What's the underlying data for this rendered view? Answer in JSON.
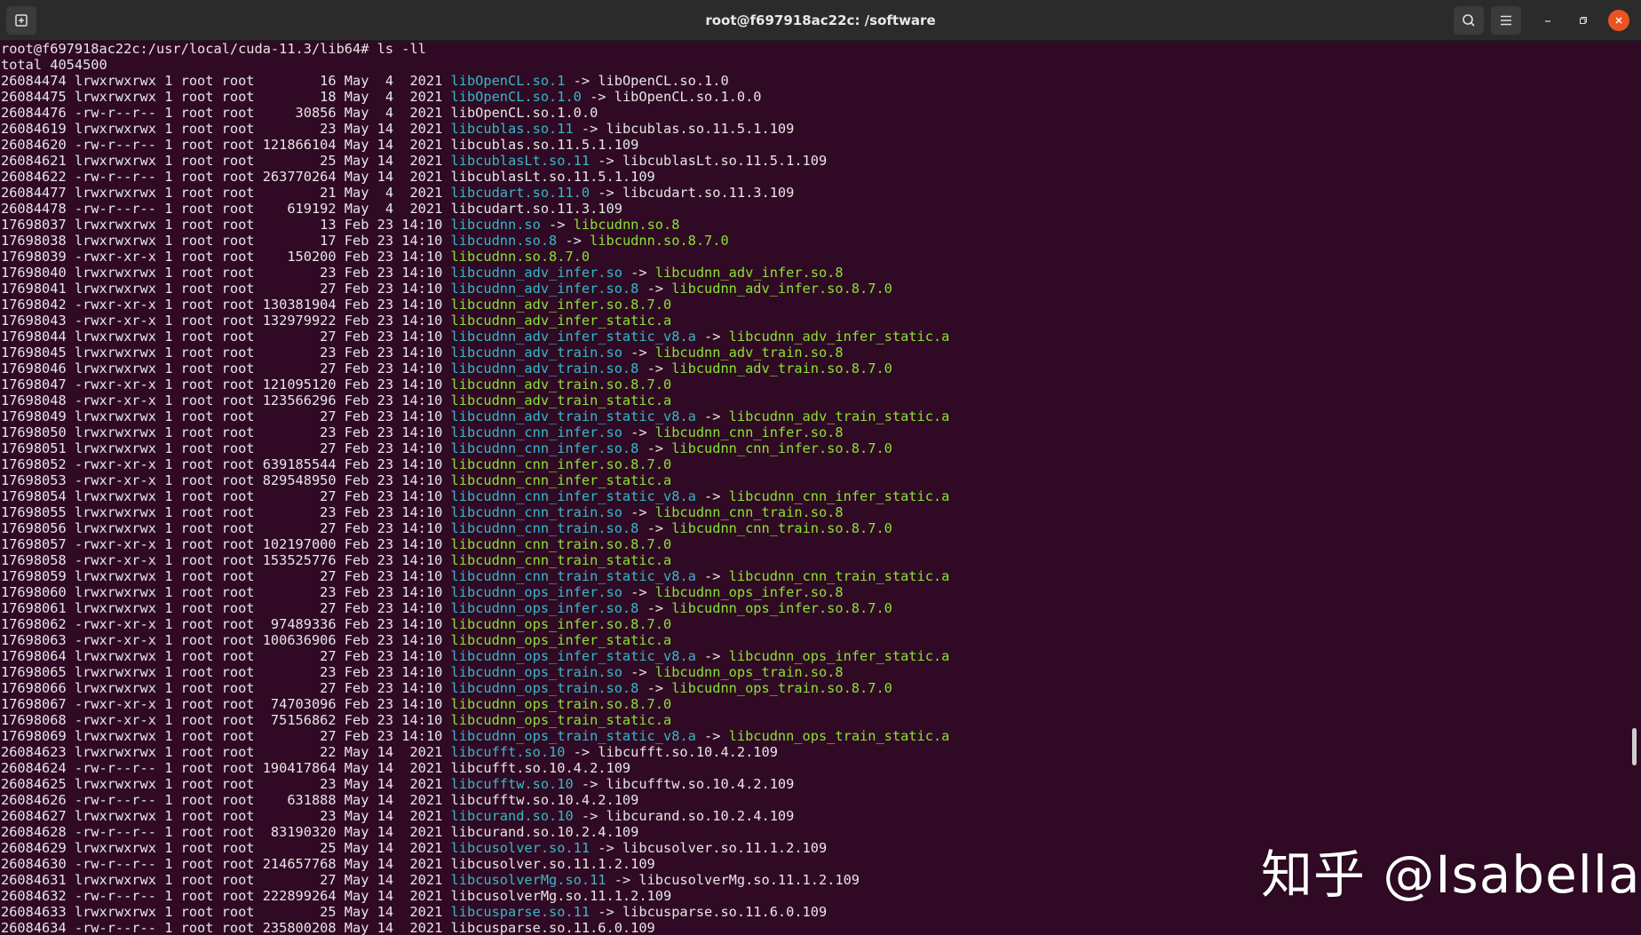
{
  "window": {
    "title": "root@f697918ac22c: /software"
  },
  "icons": {
    "new_tab": "new-tab-icon",
    "search": "search-icon",
    "menu": "hamburger-menu-icon",
    "minimize": "minimize-icon",
    "maximize": "maximize-icon",
    "close": "close-icon"
  },
  "colors": {
    "background": "#300a24",
    "titlebar": "#2b2b2b",
    "symlink": "#34b9c9",
    "executable": "#8ae234",
    "close_button": "#e95420"
  },
  "terminal": {
    "prompt": "root@f697918ac22c:/usr/local/cuda-11.3/lib64# ls -ll",
    "total": "total 4054500",
    "lines": [
      {
        "meta": "26084474 lrwxrwxrwx 1 root root        16 May  4  2021 ",
        "name": "libOpenCL.so.1",
        "kind": "link",
        "target": "libOpenCL.so.1.0",
        "tkind": "plain"
      },
      {
        "meta": "26084475 lrwxrwxrwx 1 root root        18 May  4  2021 ",
        "name": "libOpenCL.so.1.0",
        "kind": "link",
        "target": "libOpenCL.so.1.0.0",
        "tkind": "plain"
      },
      {
        "meta": "26084476 -rw-r--r-- 1 root root     30856 May  4  2021 ",
        "name": "libOpenCL.so.1.0.0",
        "kind": "plain",
        "target": "",
        "tkind": ""
      },
      {
        "meta": "26084619 lrwxrwxrwx 1 root root        23 May 14  2021 ",
        "name": "libcublas.so.11",
        "kind": "link",
        "target": "libcublas.so.11.5.1.109",
        "tkind": "plain"
      },
      {
        "meta": "26084620 -rw-r--r-- 1 root root 121866104 May 14  2021 ",
        "name": "libcublas.so.11.5.1.109",
        "kind": "plain",
        "target": "",
        "tkind": ""
      },
      {
        "meta": "26084621 lrwxrwxrwx 1 root root        25 May 14  2021 ",
        "name": "libcublasLt.so.11",
        "kind": "link",
        "target": "libcublasLt.so.11.5.1.109",
        "tkind": "plain"
      },
      {
        "meta": "26084622 -rw-r--r-- 1 root root 263770264 May 14  2021 ",
        "name": "libcublasLt.so.11.5.1.109",
        "kind": "plain",
        "target": "",
        "tkind": ""
      },
      {
        "meta": "26084477 lrwxrwxrwx 1 root root        21 May  4  2021 ",
        "name": "libcudart.so.11.0",
        "kind": "link",
        "target": "libcudart.so.11.3.109",
        "tkind": "plain"
      },
      {
        "meta": "26084478 -rw-r--r-- 1 root root    619192 May  4  2021 ",
        "name": "libcudart.so.11.3.109",
        "kind": "plain",
        "target": "",
        "tkind": ""
      },
      {
        "meta": "17698037 lrwxrwxrwx 1 root root        13 Feb 23 14:10 ",
        "name": "libcudnn.so",
        "kind": "link",
        "target": "libcudnn.so.8",
        "tkind": "exec"
      },
      {
        "meta": "17698038 lrwxrwxrwx 1 root root        17 Feb 23 14:10 ",
        "name": "libcudnn.so.8",
        "kind": "link",
        "target": "libcudnn.so.8.7.0",
        "tkind": "exec"
      },
      {
        "meta": "17698039 -rwxr-xr-x 1 root root    150200 Feb 23 14:10 ",
        "name": "libcudnn.so.8.7.0",
        "kind": "exec",
        "target": "",
        "tkind": ""
      },
      {
        "meta": "17698040 lrwxrwxrwx 1 root root        23 Feb 23 14:10 ",
        "name": "libcudnn_adv_infer.so",
        "kind": "link",
        "target": "libcudnn_adv_infer.so.8",
        "tkind": "exec"
      },
      {
        "meta": "17698041 lrwxrwxrwx 1 root root        27 Feb 23 14:10 ",
        "name": "libcudnn_adv_infer.so.8",
        "kind": "link",
        "target": "libcudnn_adv_infer.so.8.7.0",
        "tkind": "exec"
      },
      {
        "meta": "17698042 -rwxr-xr-x 1 root root 130381904 Feb 23 14:10 ",
        "name": "libcudnn_adv_infer.so.8.7.0",
        "kind": "exec",
        "target": "",
        "tkind": ""
      },
      {
        "meta": "17698043 -rwxr-xr-x 1 root root 132979922 Feb 23 14:10 ",
        "name": "libcudnn_adv_infer_static.a",
        "kind": "exec",
        "target": "",
        "tkind": ""
      },
      {
        "meta": "17698044 lrwxrwxrwx 1 root root        27 Feb 23 14:10 ",
        "name": "libcudnn_adv_infer_static_v8.a",
        "kind": "link",
        "target": "libcudnn_adv_infer_static.a",
        "tkind": "exec"
      },
      {
        "meta": "17698045 lrwxrwxrwx 1 root root        23 Feb 23 14:10 ",
        "name": "libcudnn_adv_train.so",
        "kind": "link",
        "target": "libcudnn_adv_train.so.8",
        "tkind": "exec"
      },
      {
        "meta": "17698046 lrwxrwxrwx 1 root root        27 Feb 23 14:10 ",
        "name": "libcudnn_adv_train.so.8",
        "kind": "link",
        "target": "libcudnn_adv_train.so.8.7.0",
        "tkind": "exec"
      },
      {
        "meta": "17698047 -rwxr-xr-x 1 root root 121095120 Feb 23 14:10 ",
        "name": "libcudnn_adv_train.so.8.7.0",
        "kind": "exec",
        "target": "",
        "tkind": ""
      },
      {
        "meta": "17698048 -rwxr-xr-x 1 root root 123566296 Feb 23 14:10 ",
        "name": "libcudnn_adv_train_static.a",
        "kind": "exec",
        "target": "",
        "tkind": ""
      },
      {
        "meta": "17698049 lrwxrwxrwx 1 root root        27 Feb 23 14:10 ",
        "name": "libcudnn_adv_train_static_v8.a",
        "kind": "link",
        "target": "libcudnn_adv_train_static.a",
        "tkind": "exec"
      },
      {
        "meta": "17698050 lrwxrwxrwx 1 root root        23 Feb 23 14:10 ",
        "name": "libcudnn_cnn_infer.so",
        "kind": "link",
        "target": "libcudnn_cnn_infer.so.8",
        "tkind": "exec"
      },
      {
        "meta": "17698051 lrwxrwxrwx 1 root root        27 Feb 23 14:10 ",
        "name": "libcudnn_cnn_infer.so.8",
        "kind": "link",
        "target": "libcudnn_cnn_infer.so.8.7.0",
        "tkind": "exec"
      },
      {
        "meta": "17698052 -rwxr-xr-x 1 root root 639185544 Feb 23 14:10 ",
        "name": "libcudnn_cnn_infer.so.8.7.0",
        "kind": "exec",
        "target": "",
        "tkind": ""
      },
      {
        "meta": "17698053 -rwxr-xr-x 1 root root 829548950 Feb 23 14:10 ",
        "name": "libcudnn_cnn_infer_static.a",
        "kind": "exec",
        "target": "",
        "tkind": ""
      },
      {
        "meta": "17698054 lrwxrwxrwx 1 root root        27 Feb 23 14:10 ",
        "name": "libcudnn_cnn_infer_static_v8.a",
        "kind": "link",
        "target": "libcudnn_cnn_infer_static.a",
        "tkind": "exec"
      },
      {
        "meta": "17698055 lrwxrwxrwx 1 root root        23 Feb 23 14:10 ",
        "name": "libcudnn_cnn_train.so",
        "kind": "link",
        "target": "libcudnn_cnn_train.so.8",
        "tkind": "exec"
      },
      {
        "meta": "17698056 lrwxrwxrwx 1 root root        27 Feb 23 14:10 ",
        "name": "libcudnn_cnn_train.so.8",
        "kind": "link",
        "target": "libcudnn_cnn_train.so.8.7.0",
        "tkind": "exec"
      },
      {
        "meta": "17698057 -rwxr-xr-x 1 root root 102197000 Feb 23 14:10 ",
        "name": "libcudnn_cnn_train.so.8.7.0",
        "kind": "exec",
        "target": "",
        "tkind": ""
      },
      {
        "meta": "17698058 -rwxr-xr-x 1 root root 153525776 Feb 23 14:10 ",
        "name": "libcudnn_cnn_train_static.a",
        "kind": "exec",
        "target": "",
        "tkind": ""
      },
      {
        "meta": "17698059 lrwxrwxrwx 1 root root        27 Feb 23 14:10 ",
        "name": "libcudnn_cnn_train_static_v8.a",
        "kind": "link",
        "target": "libcudnn_cnn_train_static.a",
        "tkind": "exec"
      },
      {
        "meta": "17698060 lrwxrwxrwx 1 root root        23 Feb 23 14:10 ",
        "name": "libcudnn_ops_infer.so",
        "kind": "link",
        "target": "libcudnn_ops_infer.so.8",
        "tkind": "exec"
      },
      {
        "meta": "17698061 lrwxrwxrwx 1 root root        27 Feb 23 14:10 ",
        "name": "libcudnn_ops_infer.so.8",
        "kind": "link",
        "target": "libcudnn_ops_infer.so.8.7.0",
        "tkind": "exec"
      },
      {
        "meta": "17698062 -rwxr-xr-x 1 root root  97489336 Feb 23 14:10 ",
        "name": "libcudnn_ops_infer.so.8.7.0",
        "kind": "exec",
        "target": "",
        "tkind": ""
      },
      {
        "meta": "17698063 -rwxr-xr-x 1 root root 100636906 Feb 23 14:10 ",
        "name": "libcudnn_ops_infer_static.a",
        "kind": "exec",
        "target": "",
        "tkind": ""
      },
      {
        "meta": "17698064 lrwxrwxrwx 1 root root        27 Feb 23 14:10 ",
        "name": "libcudnn_ops_infer_static_v8.a",
        "kind": "link",
        "target": "libcudnn_ops_infer_static.a",
        "tkind": "exec"
      },
      {
        "meta": "17698065 lrwxrwxrwx 1 root root        23 Feb 23 14:10 ",
        "name": "libcudnn_ops_train.so",
        "kind": "link",
        "target": "libcudnn_ops_train.so.8",
        "tkind": "exec"
      },
      {
        "meta": "17698066 lrwxrwxrwx 1 root root        27 Feb 23 14:10 ",
        "name": "libcudnn_ops_train.so.8",
        "kind": "link",
        "target": "libcudnn_ops_train.so.8.7.0",
        "tkind": "exec"
      },
      {
        "meta": "17698067 -rwxr-xr-x 1 root root  74703096 Feb 23 14:10 ",
        "name": "libcudnn_ops_train.so.8.7.0",
        "kind": "exec",
        "target": "",
        "tkind": ""
      },
      {
        "meta": "17698068 -rwxr-xr-x 1 root root  75156862 Feb 23 14:10 ",
        "name": "libcudnn_ops_train_static.a",
        "kind": "exec",
        "target": "",
        "tkind": ""
      },
      {
        "meta": "17698069 lrwxrwxrwx 1 root root        27 Feb 23 14:10 ",
        "name": "libcudnn_ops_train_static_v8.a",
        "kind": "link",
        "target": "libcudnn_ops_train_static.a",
        "tkind": "exec"
      },
      {
        "meta": "26084623 lrwxrwxrwx 1 root root        22 May 14  2021 ",
        "name": "libcufft.so.10",
        "kind": "link",
        "target": "libcufft.so.10.4.2.109",
        "tkind": "plain"
      },
      {
        "meta": "26084624 -rw-r--r-- 1 root root 190417864 May 14  2021 ",
        "name": "libcufft.so.10.4.2.109",
        "kind": "plain",
        "target": "",
        "tkind": ""
      },
      {
        "meta": "26084625 lrwxrwxrwx 1 root root        23 May 14  2021 ",
        "name": "libcufftw.so.10",
        "kind": "link",
        "target": "libcufftw.so.10.4.2.109",
        "tkind": "plain"
      },
      {
        "meta": "26084626 -rw-r--r-- 1 root root    631888 May 14  2021 ",
        "name": "libcufftw.so.10.4.2.109",
        "kind": "plain",
        "target": "",
        "tkind": ""
      },
      {
        "meta": "26084627 lrwxrwxrwx 1 root root        23 May 14  2021 ",
        "name": "libcurand.so.10",
        "kind": "link",
        "target": "libcurand.so.10.2.4.109",
        "tkind": "plain"
      },
      {
        "meta": "26084628 -rw-r--r-- 1 root root  83190320 May 14  2021 ",
        "name": "libcurand.so.10.2.4.109",
        "kind": "plain",
        "target": "",
        "tkind": ""
      },
      {
        "meta": "26084629 lrwxrwxrwx 1 root root        25 May 14  2021 ",
        "name": "libcusolver.so.11",
        "kind": "link",
        "target": "libcusolver.so.11.1.2.109",
        "tkind": "plain"
      },
      {
        "meta": "26084630 -rw-r--r-- 1 root root 214657768 May 14  2021 ",
        "name": "libcusolver.so.11.1.2.109",
        "kind": "plain",
        "target": "",
        "tkind": ""
      },
      {
        "meta": "26084631 lrwxrwxrwx 1 root root        27 May 14  2021 ",
        "name": "libcusolverMg.so.11",
        "kind": "link",
        "target": "libcusolverMg.so.11.1.2.109",
        "tkind": "plain"
      },
      {
        "meta": "26084632 -rw-r--r-- 1 root root 222899264 May 14  2021 ",
        "name": "libcusolverMg.so.11.1.2.109",
        "kind": "plain",
        "target": "",
        "tkind": ""
      },
      {
        "meta": "26084633 lrwxrwxrwx 1 root root        25 May 14  2021 ",
        "name": "libcusparse.so.11",
        "kind": "link",
        "target": "libcusparse.so.11.6.0.109",
        "tkind": "plain"
      },
      {
        "meta": "26084634 -rw-r--r-- 1 root root 235800208 May 14  2021 ",
        "name": "libcusparse.so.11.6.0.109",
        "kind": "plain",
        "target": "",
        "tkind": ""
      }
    ]
  },
  "watermark": "知乎 @Isabella"
}
